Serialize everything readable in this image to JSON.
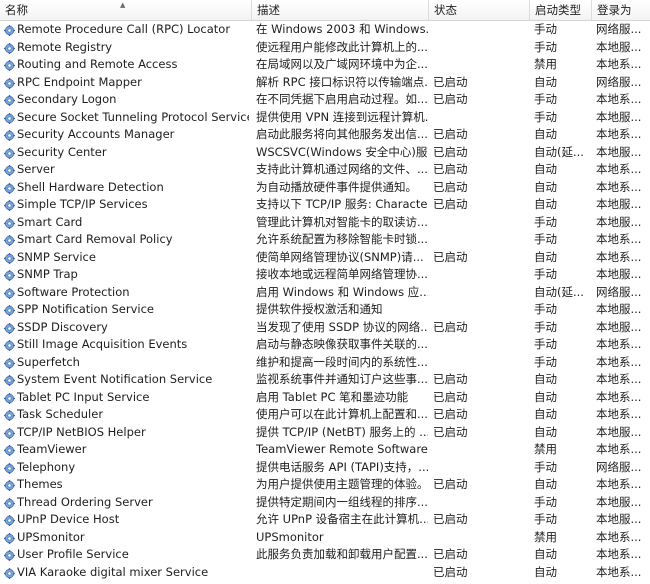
{
  "columns": {
    "name": "名称",
    "description": "描述",
    "status": "状态",
    "startup": "启动类型",
    "logon": "登录为"
  },
  "rows": [
    {
      "name": "Remote Procedure Call (RPC) Locator",
      "description": "在 Windows 2003 和 Windows...",
      "status": "",
      "startup": "手动",
      "logon": "网络服..."
    },
    {
      "name": "Remote Registry",
      "description": "使远程用户能修改此计算机上的...",
      "status": "",
      "startup": "手动",
      "logon": "本地服..."
    },
    {
      "name": "Routing and Remote Access",
      "description": "在局域网以及广域网环境中为企...",
      "status": "",
      "startup": "禁用",
      "logon": "本地系..."
    },
    {
      "name": "RPC Endpoint Mapper",
      "description": "解析 RPC 接口标识符以传输端点...",
      "status": "已启动",
      "startup": "自动",
      "logon": "网络服..."
    },
    {
      "name": "Secondary Logon",
      "description": "在不同凭据下启用启动过程。如...",
      "status": "已启动",
      "startup": "手动",
      "logon": "本地系..."
    },
    {
      "name": "Secure Socket Tunneling Protocol Service",
      "description": "提供使用 VPN 连接到远程计算机...",
      "status": "",
      "startup": "手动",
      "logon": "本地服..."
    },
    {
      "name": "Security Accounts Manager",
      "description": "启动此服务将向其他服务发出信...",
      "status": "已启动",
      "startup": "自动",
      "logon": "本地系..."
    },
    {
      "name": "Security Center",
      "description": "WSCSVC(Windows 安全中心)服...",
      "status": "已启动",
      "startup": "自动(延...",
      "logon": "本地服..."
    },
    {
      "name": "Server",
      "description": "支持此计算机通过网络的文件、...",
      "status": "已启动",
      "startup": "自动",
      "logon": "本地系..."
    },
    {
      "name": "Shell Hardware Detection",
      "description": "为自动播放硬件事件提供通知。",
      "status": "已启动",
      "startup": "自动",
      "logon": "本地系..."
    },
    {
      "name": "Simple TCP/IP Services",
      "description": "支持以下 TCP/IP 服务: Characte...",
      "status": "已启动",
      "startup": "自动",
      "logon": "本地服..."
    },
    {
      "name": "Smart Card",
      "description": "管理此计算机对智能卡的取读访...",
      "status": "",
      "startup": "手动",
      "logon": "本地服..."
    },
    {
      "name": "Smart Card Removal Policy",
      "description": "允许系统配置为移除智能卡时锁...",
      "status": "",
      "startup": "手动",
      "logon": "本地系..."
    },
    {
      "name": "SNMP Service",
      "description": "使简单网络管理协议(SNMP)请...",
      "status": "已启动",
      "startup": "自动",
      "logon": "本地系..."
    },
    {
      "name": "SNMP Trap",
      "description": "接收本地或远程简单网络管理协...",
      "status": "",
      "startup": "手动",
      "logon": "本地服..."
    },
    {
      "name": "Software Protection",
      "description": "启用 Windows 和 Windows 应...",
      "status": "",
      "startup": "自动(延...",
      "logon": "网络服..."
    },
    {
      "name": "SPP Notification Service",
      "description": "提供软件授权激活和通知",
      "status": "",
      "startup": "手动",
      "logon": "本地服..."
    },
    {
      "name": "SSDP Discovery",
      "description": "当发现了使用 SSDP 协议的网络...",
      "status": "已启动",
      "startup": "手动",
      "logon": "本地服..."
    },
    {
      "name": "Still Image Acquisition Events",
      "description": "启动与静态映像获取事件关联的...",
      "status": "",
      "startup": "手动",
      "logon": "本地系..."
    },
    {
      "name": "Superfetch",
      "description": "维护和提高一段时间内的系统性...",
      "status": "",
      "startup": "手动",
      "logon": "本地系..."
    },
    {
      "name": "System Event Notification Service",
      "description": "监视系统事件并通知订户这些事...",
      "status": "已启动",
      "startup": "自动",
      "logon": "本地系..."
    },
    {
      "name": "Tablet PC Input Service",
      "description": "启用 Tablet PC 笔和墨迹功能",
      "status": "已启动",
      "startup": "自动",
      "logon": "本地系..."
    },
    {
      "name": "Task Scheduler",
      "description": "使用户可以在此计算机上配置和...",
      "status": "已启动",
      "startup": "自动",
      "logon": "本地系..."
    },
    {
      "name": "TCP/IP NetBIOS Helper",
      "description": "提供 TCP/IP (NetBT) 服务上的 ...",
      "status": "已启动",
      "startup": "自动",
      "logon": "本地服..."
    },
    {
      "name": "TeamViewer",
      "description": "TeamViewer Remote Software",
      "status": "",
      "startup": "禁用",
      "logon": "本地系..."
    },
    {
      "name": "Telephony",
      "description": "提供电话服务 API (TAPI)支持，...",
      "status": "",
      "startup": "手动",
      "logon": "网络服..."
    },
    {
      "name": "Themes",
      "description": "为用户提供使用主题管理的体验。",
      "status": "已启动",
      "startup": "自动",
      "logon": "本地系..."
    },
    {
      "name": "Thread Ordering Server",
      "description": "提供特定期间内一组线程的排序...",
      "status": "",
      "startup": "手动",
      "logon": "本地服..."
    },
    {
      "name": "UPnP Device Host",
      "description": "允许 UPnP 设备宿主在此计算机...",
      "status": "已启动",
      "startup": "手动",
      "logon": "本地服..."
    },
    {
      "name": "UPSmonitor",
      "description": "UPSmonitor",
      "status": "",
      "startup": "禁用",
      "logon": "本地系..."
    },
    {
      "name": "User Profile Service",
      "description": "此服务负责加载和卸载用户配置...",
      "status": "已启动",
      "startup": "自动",
      "logon": "本地系..."
    },
    {
      "name": "VIA Karaoke digital mixer Service",
      "description": "",
      "status": "已启动",
      "startup": "自动",
      "logon": "本地系..."
    }
  ],
  "icons": {
    "row_icon": "gear-icon",
    "sort_icon": "sort-ascending-icon"
  },
  "colors": {
    "header_border": "#d5d5d5",
    "icon_blue": "#5a86c4"
  }
}
